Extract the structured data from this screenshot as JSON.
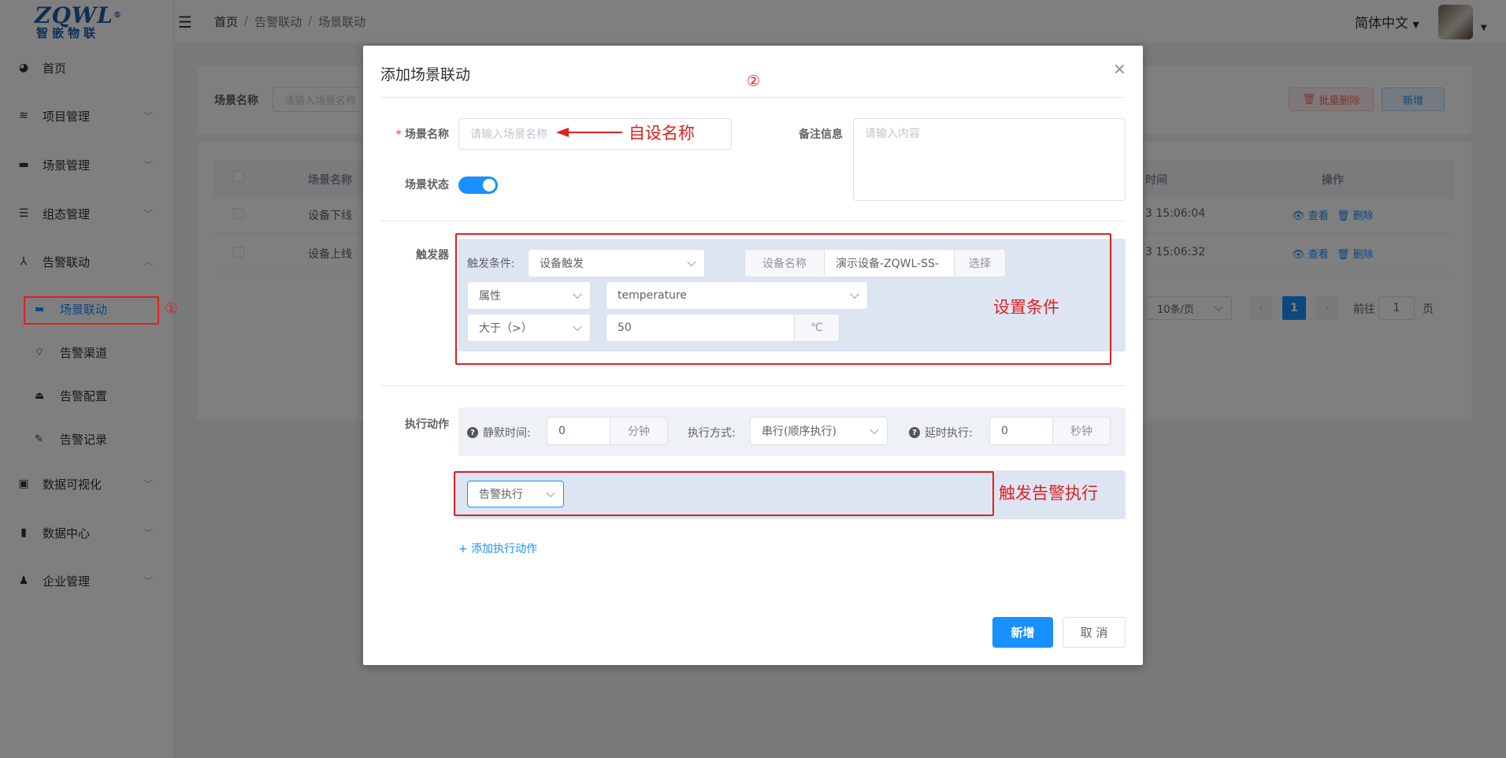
{
  "logo": {
    "brand": "ZQWL",
    "reg": "®",
    "sub": "智嵌物联"
  },
  "header": {
    "breadcrumb": [
      "首页",
      "告警联动",
      "场景联动"
    ],
    "language": "简体中文"
  },
  "sidebar": {
    "items": [
      {
        "label": "首页",
        "icon": "dashboard-icon"
      },
      {
        "label": "项目管理",
        "icon": "layers-icon"
      },
      {
        "label": "场景管理",
        "icon": "clapper-icon"
      },
      {
        "label": "组态管理",
        "icon": "server-icon"
      },
      {
        "label": "告警联动",
        "icon": "network-icon"
      },
      {
        "label": "数据可视化",
        "icon": "monitor-icon"
      },
      {
        "label": "数据中心",
        "icon": "bar-chart-icon"
      },
      {
        "label": "企业管理",
        "icon": "user-gear-icon"
      }
    ],
    "subitems": [
      {
        "label": "场景联动",
        "icon": "clapper-icon"
      },
      {
        "label": "告警渠道",
        "icon": "tag-icon"
      },
      {
        "label": "告警配置",
        "icon": "alarm-icon"
      },
      {
        "label": "告警记录",
        "icon": "edit-icon"
      }
    ]
  },
  "background": {
    "search_label": "场景名称",
    "search_placeholder": "请输入场景名称",
    "batch_delete": "批量删除",
    "add": "新增",
    "table": {
      "col_name": "场景名称",
      "col_time": "时间",
      "col_ops": "操作",
      "rows": [
        {
          "name": "设备下线",
          "time": "3 15:06:04"
        },
        {
          "name": "设备上线",
          "time": "3 15:06:32"
        }
      ],
      "view": "查看",
      "delete": "删除"
    },
    "pagination": {
      "per_page": "10条/页",
      "page": "1",
      "goto_label": "前往",
      "goto_value": "1",
      "page_suffix": "页"
    }
  },
  "dialog": {
    "title": "添加场景联动",
    "scene_name_label": "场景名称",
    "scene_name_placeholder": "请输入场景名称",
    "remark_label": "备注信息",
    "remark_placeholder": "请输入内容",
    "status_label": "场景状态",
    "trigger": {
      "label": "触发器",
      "condition_label": "触发条件:",
      "condition_value": "设备触发",
      "device_name_label": "设备名称",
      "device_name_value": "演示设备-ZQWL-SS-",
      "select_btn": "选择",
      "attr_type": "属性",
      "attr_name": "temperature",
      "operator": "大于（>）",
      "threshold": "50",
      "unit": "℃"
    },
    "action": {
      "label": "执行动作",
      "silent_label": "静默时间:",
      "silent_value": "0",
      "silent_unit": "分钟",
      "mode_label": "执行方式:",
      "mode_value": "串行(顺序执行)",
      "delay_label": "延时执行:",
      "delay_value": "0",
      "delay_unit": "秒钟",
      "action_type": "告警执行",
      "add_action": "+ 添加执行动作"
    },
    "submit": "新增",
    "cancel": "取 消"
  },
  "annotations": {
    "a1": "①",
    "a2": "②",
    "name_hint": "自设名称",
    "condition_hint": "设置条件",
    "action_hint": "触发告警执行"
  },
  "colors": {
    "primary": "#1890ff",
    "annotation": "#e02020",
    "panel": "#dde5f3"
  }
}
